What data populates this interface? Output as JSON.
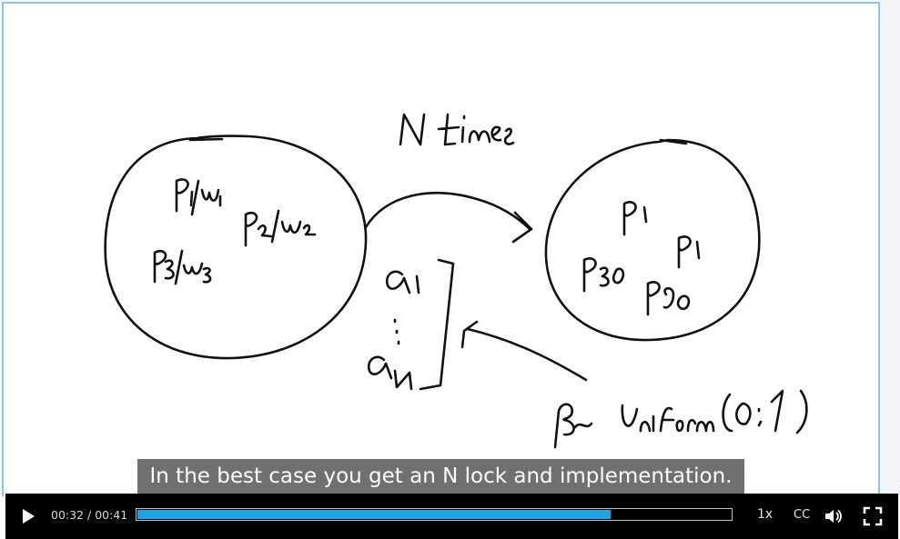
{
  "video": {
    "subtitle": "In the best case you get an N lock and implementation.",
    "current_time": "00:32",
    "separator": " / ",
    "duration": "00:41",
    "progress_fraction": 0.797,
    "speed_label": "1x",
    "cc_label": "CC",
    "accent_color": "#1ca4e6"
  },
  "icons": {
    "play": "play-icon",
    "volume": "volume-icon",
    "fullscreen": "fullscreen-icon"
  }
}
